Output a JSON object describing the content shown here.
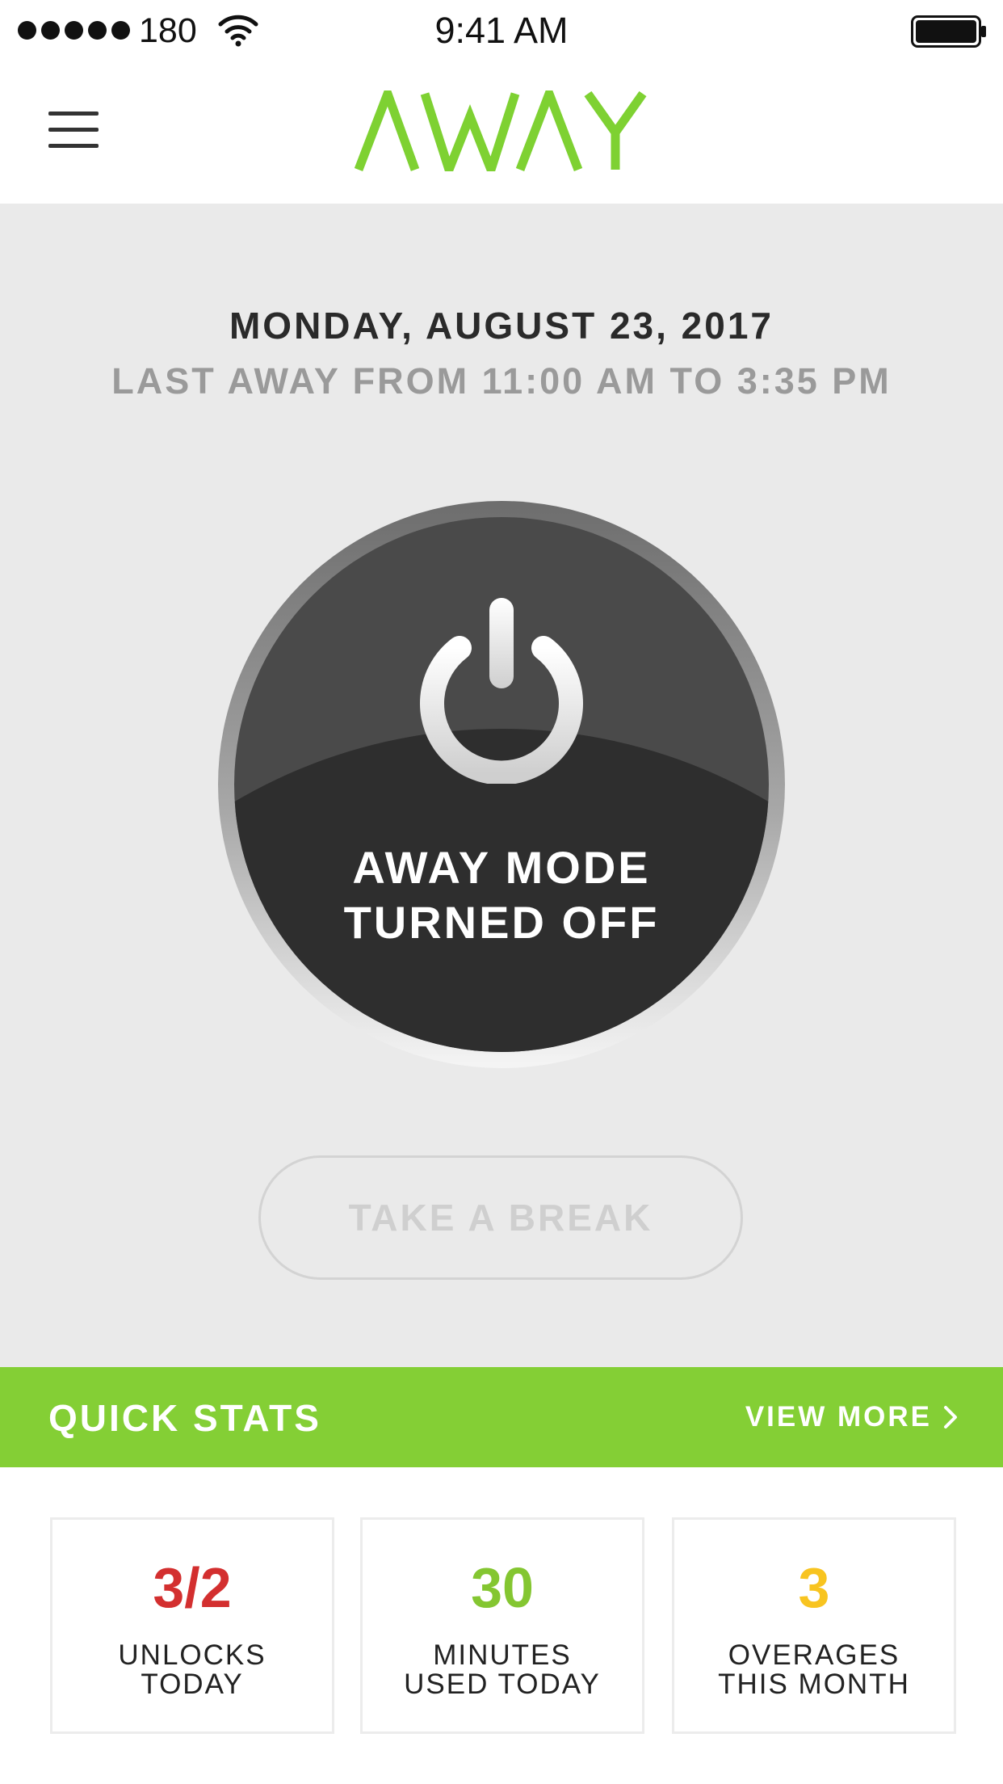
{
  "status_bar": {
    "carrier": "180",
    "time": "9:41 AM"
  },
  "header": {
    "logo_text": "AWAY",
    "brand_color": "#7ed132"
  },
  "main": {
    "date": "MONDAY, AUGUST 23, 2017",
    "last_away": "LAST AWAY FROM 11:00 AM TO 3:35 PM",
    "power_button": {
      "label_line1": "AWAY MODE",
      "label_line2": "TURNED OFF",
      "icon": "power-icon"
    },
    "break_button": "TAKE A BREAK"
  },
  "quick_stats": {
    "title": "QUICK STATS",
    "view_more": "VIEW MORE",
    "bar_color": "#84cf35",
    "cards": [
      {
        "value": "3/2",
        "label_line1": "UNLOCKS",
        "label_line2": "TODAY",
        "color": "#d32f2f"
      },
      {
        "value": "30",
        "label_line1": "MINUTES",
        "label_line2": "USED TODAY",
        "color": "#84c631"
      },
      {
        "value": "3",
        "label_line1": "OVERAGES",
        "label_line2": "THIS MONTH",
        "color": "#f8c420"
      }
    ]
  }
}
